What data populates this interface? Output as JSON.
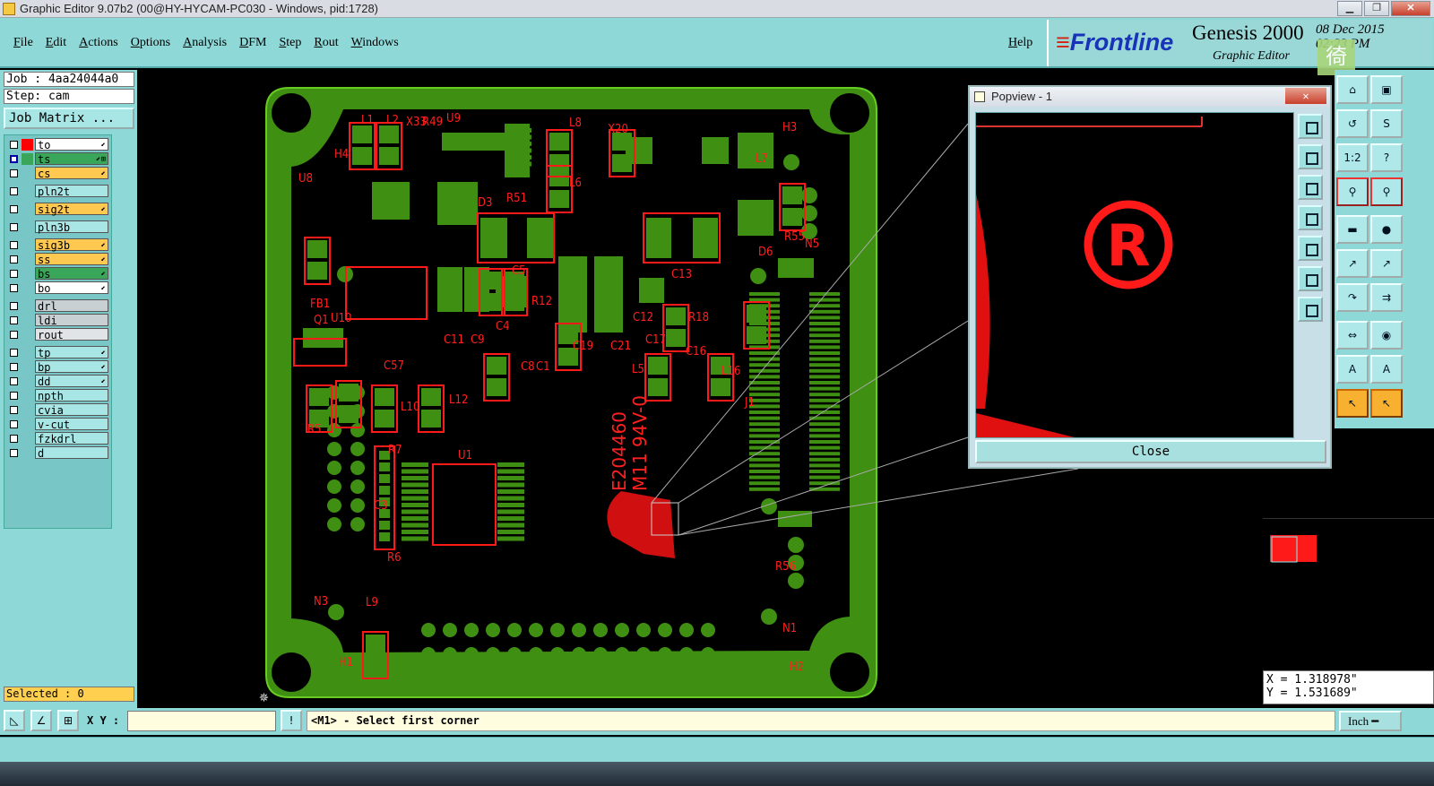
{
  "window": {
    "title": "Graphic Editor 9.07b2 (00@HY-HYCAM-PC030 - Windows, pid:1728)",
    "controls": [
      "minimize",
      "restore",
      "close"
    ]
  },
  "menu": {
    "items": [
      "File",
      "Edit",
      "Actions",
      "Options",
      "Analysis",
      "DFM",
      "Step",
      "Rout",
      "Windows"
    ],
    "help": "Help"
  },
  "brand": {
    "logo": "Frontline",
    "product": "Genesis 2000",
    "subtitle": "Graphic Editor",
    "date": "08 Dec 2015",
    "time": "02:23 PM",
    "badge": "徛"
  },
  "job": {
    "job_label": "Job : 4aa24044a0",
    "step_label": "Step: cam",
    "matrix_button": "Job Matrix ..."
  },
  "layers": [
    {
      "name": "to",
      "color": "#ffffff",
      "swatch": "#ff0000",
      "checked": false,
      "mark": "⬋"
    },
    {
      "name": "ts",
      "color": "#3aa65a",
      "swatch": "#3aa65a",
      "checked": true,
      "mark": "⬋⊞"
    },
    {
      "name": "cs",
      "color": "#ffc850",
      "swatch": "",
      "checked": false,
      "mark": "⬋"
    },
    {
      "name": "pln2t",
      "color": "#a8e6e6",
      "swatch": "",
      "checked": false,
      "mark": ""
    },
    {
      "name": "sig2t",
      "color": "#ffc850",
      "swatch": "",
      "checked": false,
      "mark": "⬋"
    },
    {
      "name": "pln3b",
      "color": "#a8e6e6",
      "swatch": "",
      "checked": false,
      "mark": ""
    },
    {
      "name": "sig3b",
      "color": "#ffc850",
      "swatch": "",
      "checked": false,
      "mark": "⬋"
    },
    {
      "name": "ss",
      "color": "#ffc850",
      "swatch": "",
      "checked": false,
      "mark": "⬋"
    },
    {
      "name": "bs",
      "color": "#3aa65a",
      "swatch": "",
      "checked": false,
      "mark": "⬋"
    },
    {
      "name": "bo",
      "color": "#ffffff",
      "swatch": "",
      "checked": false,
      "mark": "⬋"
    },
    {
      "name": "drl",
      "color": "#c8d0d4",
      "swatch": "",
      "checked": false,
      "mark": ""
    },
    {
      "name": "ldi",
      "color": "#c8d0d4",
      "swatch": "",
      "checked": false,
      "mark": ""
    },
    {
      "name": "rout",
      "color": "#e0e4e6",
      "swatch": "",
      "checked": false,
      "mark": ""
    },
    {
      "name": "tp",
      "color": "#a8e6e6",
      "swatch": "",
      "checked": false,
      "mark": "⬋"
    },
    {
      "name": "bp",
      "color": "#a8e6e6",
      "swatch": "",
      "checked": false,
      "mark": "⬋"
    },
    {
      "name": "dd",
      "color": "#a8e6e6",
      "swatch": "",
      "checked": false,
      "mark": "⬋"
    },
    {
      "name": "npth",
      "color": "#a8e6e6",
      "swatch": "",
      "checked": false,
      "mark": ""
    },
    {
      "name": "cvia",
      "color": "#a8e6e6",
      "swatch": "",
      "checked": false,
      "mark": ""
    },
    {
      "name": "v-cut",
      "color": "#a8e6e6",
      "swatch": "",
      "checked": false,
      "mark": ""
    },
    {
      "name": "fzkdrl",
      "color": "#a8e6e6",
      "swatch": "",
      "checked": false,
      "mark": ""
    },
    {
      "name": "d",
      "color": "#a8e6e6",
      "swatch": "",
      "checked": false,
      "mark": ""
    }
  ],
  "selected": "Selected : 0",
  "board": {
    "refdes": [
      "L1",
      "L2",
      "X33",
      "R49",
      "U9",
      "L8",
      "X20",
      "H3",
      "H4",
      "U8",
      "D3",
      "R51",
      "L6",
      "L7",
      "N5",
      "R55",
      "D6",
      "FB1",
      "C5",
      "C13",
      "Q1",
      "U10",
      "R12",
      "C11",
      "C9",
      "C4",
      "C19",
      "C21",
      "C12",
      "C17",
      "R18",
      "C16",
      "C8",
      "C1",
      "C57",
      "L5",
      "L16",
      "R5",
      "L10",
      "L12",
      "J1",
      "R7",
      "U1",
      "C3",
      "R6",
      "R56",
      "N3",
      "L9",
      "H1",
      "N1",
      "H2"
    ],
    "marking_line1": "E204460",
    "marking_line2": "M11 94V-0"
  },
  "popview": {
    "title": "Popview - 1",
    "close_label": "Close",
    "symbol": "R"
  },
  "coords": {
    "x": "X = 1.318978\"",
    "y": "Y = 1.531689\""
  },
  "bottom": {
    "xy_label": "X Y :",
    "xy_value": "",
    "prompt": "<M1> - Select first corner",
    "units": "Inch ━"
  },
  "colors": {
    "board": "#3f8f12",
    "silk": "#ff0000",
    "panel": "#8fd8d8"
  }
}
